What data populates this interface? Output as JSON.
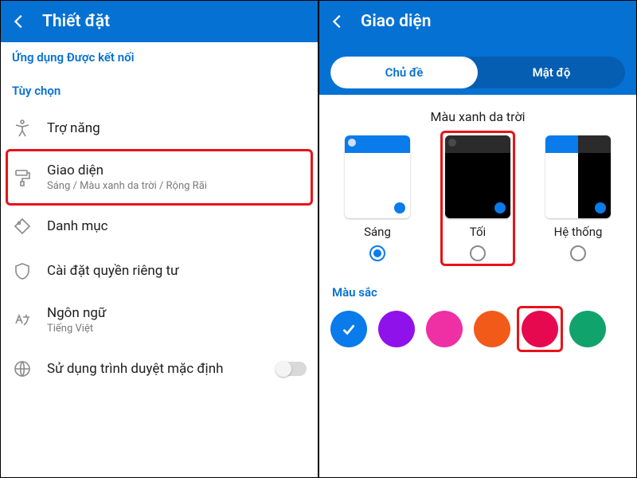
{
  "left": {
    "header_title": "Thiết đặt",
    "section_linked": "Ứng dụng Được kết nối",
    "section_options": "Tùy chọn",
    "items": {
      "accessibility": {
        "title": "Trợ năng"
      },
      "appearance": {
        "title": "Giao diện",
        "sub": "Sáng / Màu xanh da trời / Rộng Rãi"
      },
      "category": {
        "title": "Danh mục"
      },
      "privacy": {
        "title": "Cài đặt quyền riêng tư"
      },
      "language": {
        "title": "Ngôn ngữ",
        "sub": "Tiếng Việt"
      },
      "browser": {
        "title": "Sử dụng trình duyệt mặc định"
      }
    }
  },
  "right": {
    "header_title": "Giao diện",
    "seg_theme": "Chủ đề",
    "seg_density": "Mật độ",
    "theme_name": "Màu xanh da trời",
    "theme_opts": {
      "light": "Sáng",
      "dark": "Tối",
      "system": "Hệ thống"
    },
    "color_section": "Màu sắc",
    "colors": {
      "blue": "#0a7bea",
      "purple": "#9012ea",
      "pink": "#ef2fa4",
      "orange": "#f25a1a",
      "magenta": "#e6094f",
      "green": "#11a36c"
    }
  },
  "highlight_targets": {
    "left_item": "appearance",
    "right_theme": "dark",
    "right_color": "magenta"
  }
}
